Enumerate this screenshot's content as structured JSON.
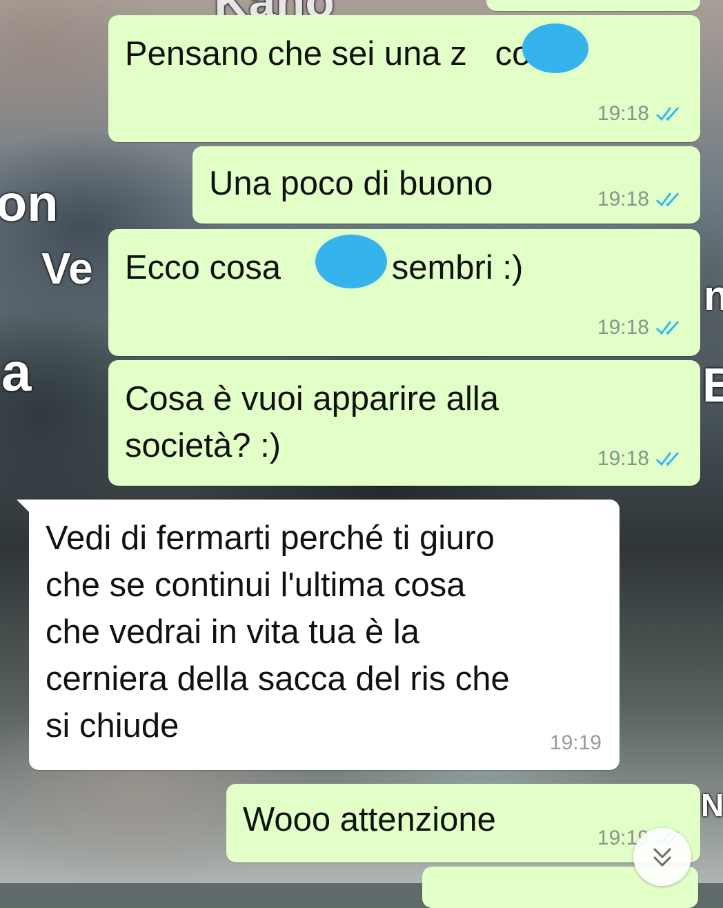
{
  "wallpaper": {
    "texts": [
      "Kano",
      "on",
      "Ve",
      "a",
      "nr",
      "B",
      "N"
    ]
  },
  "messages": [
    {
      "id": "m1",
      "direction": "outgoing",
      "text": "Pensano che sei una z   cola",
      "time": "19:18",
      "status": "read"
    },
    {
      "id": "m2",
      "direction": "outgoing",
      "text": "Una poco di buono",
      "time": "19:18",
      "status": "read"
    },
    {
      "id": "m3",
      "direction": "outgoing",
      "text": "Ecco cosa       zo sembri :)",
      "time": "19:18",
      "status": "read"
    },
    {
      "id": "m4",
      "direction": "outgoing",
      "text": "Cosa è vuoi apparire alla\nsocietà? :)",
      "time": "19:18",
      "status": "read"
    },
    {
      "id": "m5",
      "direction": "incoming",
      "text": "Vedi di fermarti perché ti giuro\nche se continui l'ultima cosa\nche vedrai in vita tua è la\ncerniera della sacca del ris che\nsi chiude",
      "time": "19:19"
    },
    {
      "id": "m6",
      "direction": "outgoing",
      "text": "Wooo attenzione",
      "time": "19:19",
      "status": "read"
    }
  ],
  "colors": {
    "outgoing_bubble": "#e2ffc7",
    "incoming_bubble": "#ffffff",
    "read_ticks": "#34b7f1",
    "redaction": "#35b3ec"
  },
  "icons": {
    "read_receipt": "double-check-icon",
    "scroll_down": "chevron-double-down-icon"
  }
}
